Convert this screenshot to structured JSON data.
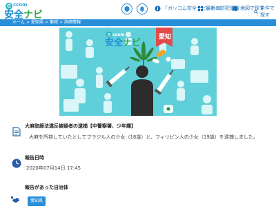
{
  "header": {
    "logo_small": "ccom",
    "logo_main_a": "安全",
    "logo_main_b": "ナビ",
    "nav": [
      {
        "label": "「ガッコム安全ナビ」とは"
      },
      {
        "label": "最新の防犯情報"
      },
      {
        "label": "地図で探す"
      },
      {
        "label": "条件で探す"
      }
    ]
  },
  "breadcrumb": [
    "ホーム",
    "愛知県",
    "薬物",
    "詳細情報"
  ],
  "hero": {
    "logo_small": "ccom",
    "logo_main_a": "安全",
    "logo_main_b": "ナビ",
    "tag": "愛知"
  },
  "article": {
    "title": "大麻取締法違反被疑者の逮捕【中警察署、少年課】",
    "description": "大麻を所持していたとしてブラジル人の少女（18歳）と、フィリピン人の少女（19歳）を逮捕しました。"
  },
  "report_date": {
    "label": "報告日時",
    "value": "2020年07月14日 17:45"
  },
  "municipality": {
    "label": "報告があった自治体",
    "badge": "愛知県"
  },
  "colors": {
    "accent": "#2a8fd9",
    "hero_bg": "#5fd0d9",
    "tag_red": "#e24a4a"
  }
}
